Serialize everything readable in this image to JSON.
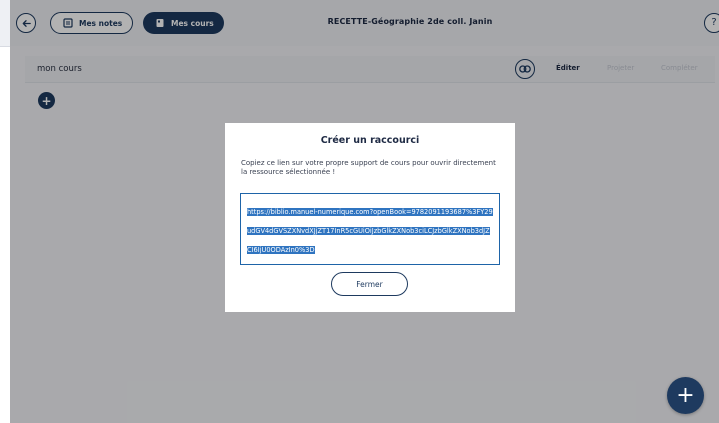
{
  "header": {
    "back_icon": "arrow-left-icon",
    "notes_label": "Mes notes",
    "notes_icon": "notes-icon",
    "courses_label": "Mes cours",
    "courses_icon": "course-icon",
    "title": "RECETTE-Géographie 2de coll. Janin",
    "help_icon": "question-icon"
  },
  "course": {
    "name": "mon cours",
    "link_icon": "link-icon",
    "actions": {
      "edit": "Éditer",
      "project": "Projeter",
      "complete": "Compléter"
    },
    "add_icon": "plus-icon"
  },
  "modal": {
    "title": "Créer un raccourci",
    "description": "Copiez ce lien sur votre propre support de cours pour ouvrir directement la ressource sélectionnée !",
    "link": "https://biblio.manuel-numerique.com?openBook=9782091193687%3FY29udGV4dGVSZXNvdXJjZT17InR5cGUiOiJzbGlkZXNob3ciLCJzbGlkZXNob3dJZCI6IjU0ODAzIn0%3D",
    "close_label": "Fermer"
  },
  "fab": {
    "icon": "plus-icon"
  },
  "colors": {
    "primary": "#1e3a5f",
    "selection": "#2f74c0",
    "disabled": "#c4c8d2"
  }
}
